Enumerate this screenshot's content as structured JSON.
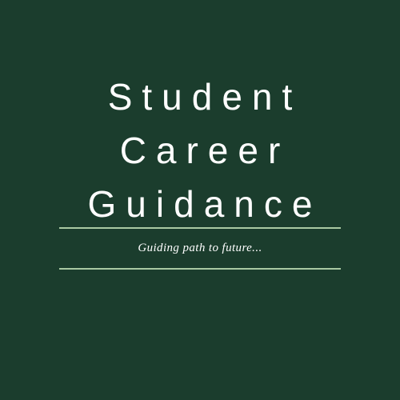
{
  "title": {
    "lines": [
      "Student",
      "Career",
      "Guidance"
    ]
  },
  "tagline": "Guiding path to future...",
  "colors": {
    "background": "#1b3d2d",
    "text": "#ffffff",
    "rule": "#a9c9a3"
  }
}
